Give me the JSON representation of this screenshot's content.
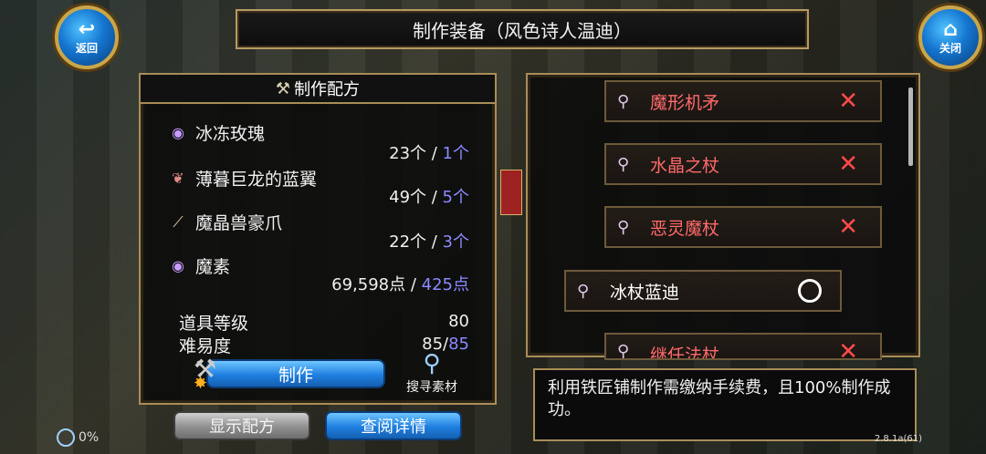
{
  "header": {
    "title": "制作装备（风色诗人温迪）",
    "back_label": "返回",
    "close_label": "关闭"
  },
  "recipe": {
    "title": "制作配方",
    "materials": [
      {
        "name": "冰冻玫瑰",
        "have": "23个",
        "sep": " / ",
        "need": "1个",
        "icon": "purple-gem-icon"
      },
      {
        "name": "薄暮巨龙的蓝翼",
        "have": "49个",
        "sep": " / ",
        "need": "5个",
        "icon": "wing-icon"
      },
      {
        "name": "魔晶兽豪爪",
        "have": "22个",
        "sep": " / ",
        "need": "3个",
        "icon": "claw-icon"
      },
      {
        "name": "魔素",
        "have": "69,598点",
        "sep": " / ",
        "need": "425点",
        "icon": "purple-gem-icon"
      }
    ],
    "item_level_label": "道具等级",
    "item_level_value": "80",
    "difficulty_label": "难易度",
    "difficulty_current": "85/",
    "difficulty_required": "85",
    "make_label": "制作",
    "search_label": "搜寻素材",
    "show_recipe_label": "显示配方",
    "view_details_label": "查阅详情"
  },
  "equipment_list": [
    {
      "name": "魔形机矛",
      "status": "unavailable",
      "mark": "✕"
    },
    {
      "name": "水晶之杖",
      "status": "unavailable",
      "mark": "✕"
    },
    {
      "name": "恶灵魔杖",
      "status": "unavailable",
      "mark": "✕"
    },
    {
      "name": "冰杖蓝迪",
      "status": "available",
      "mark": ""
    },
    {
      "name": "继任法杖",
      "status": "unavailable",
      "mark": "✕"
    }
  ],
  "description": "利用铁匠铺制作需缴纳手续费，且100%制作成功。",
  "footer": {
    "progress": "0%",
    "version": "2.8.1a(61)"
  },
  "colors": {
    "unavailable_text": "#ff6a6a",
    "available_text": "#ffffff",
    "required_text": "#8a8aff",
    "border_gold": "#a98d58",
    "button_blue": "#1f7fe0"
  }
}
